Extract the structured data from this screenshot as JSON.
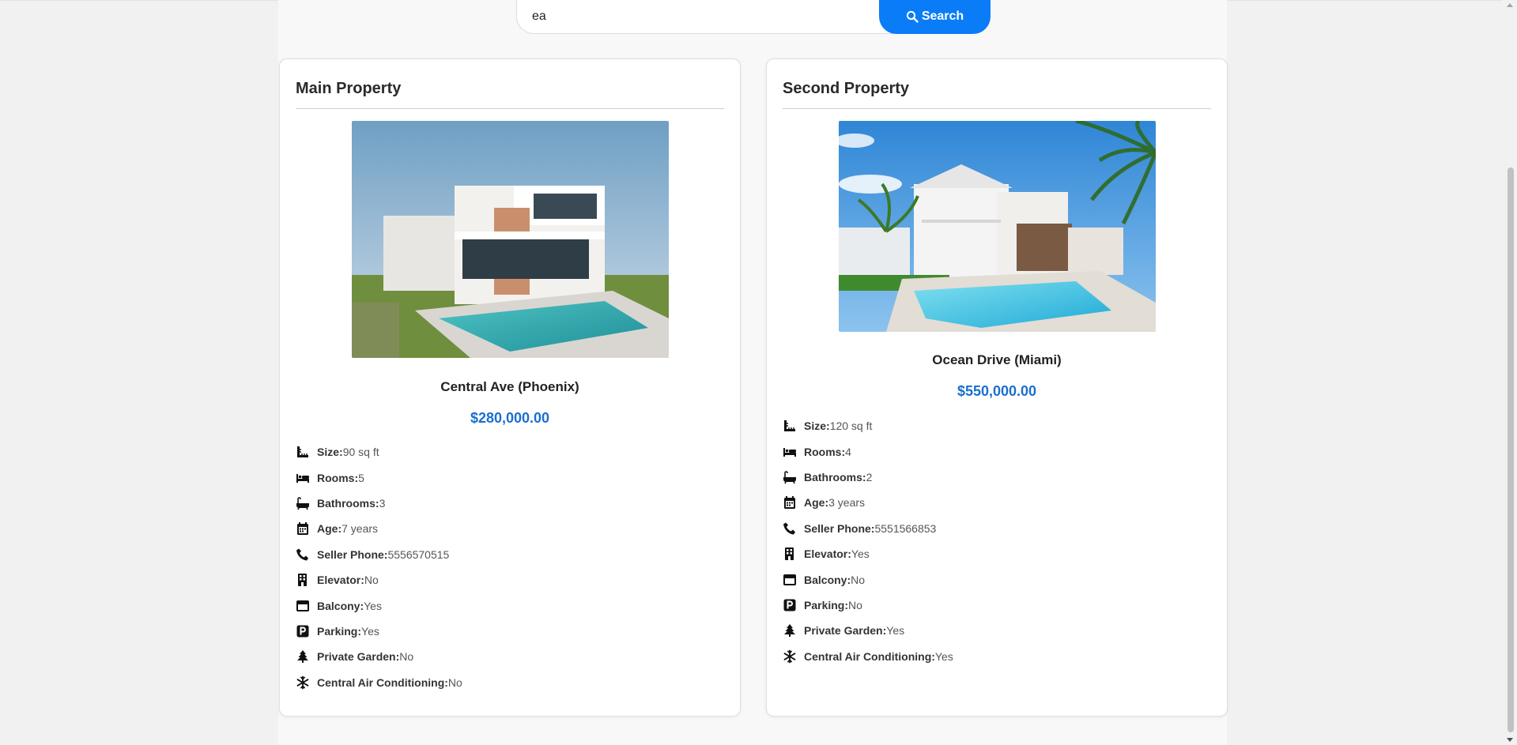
{
  "search": {
    "value": "ea",
    "placeholder": "",
    "button_label": "Search"
  },
  "properties": [
    {
      "section_title": "Main Property",
      "name": "Central Ave (Phoenix)",
      "price": "$280,000.00",
      "details": [
        {
          "icon": "ruler-icon",
          "label": "Size:",
          "value": "90 sq ft"
        },
        {
          "icon": "bed-icon",
          "label": "Rooms:",
          "value": "5"
        },
        {
          "icon": "bath-icon",
          "label": "Bathrooms:",
          "value": "3"
        },
        {
          "icon": "calendar-icon",
          "label": "Age:",
          "value": "7 years"
        },
        {
          "icon": "phone-icon",
          "label": "Seller Phone:",
          "value": "5556570515"
        },
        {
          "icon": "building-icon",
          "label": "Elevator:",
          "value": "No"
        },
        {
          "icon": "balcony-icon",
          "label": "Balcony:",
          "value": "Yes"
        },
        {
          "icon": "parking-icon",
          "label": "Parking:",
          "value": "Yes"
        },
        {
          "icon": "tree-icon",
          "label": "Private Garden:",
          "value": "No"
        },
        {
          "icon": "snowflake-icon",
          "label": "Central Air Conditioning:",
          "value": "No"
        }
      ]
    },
    {
      "section_title": "Second Property",
      "name": "Ocean Drive (Miami)",
      "price": "$550,000.00",
      "details": [
        {
          "icon": "ruler-icon",
          "label": "Size:",
          "value": "120 sq ft"
        },
        {
          "icon": "bed-icon",
          "label": "Rooms:",
          "value": "4"
        },
        {
          "icon": "bath-icon",
          "label": "Bathrooms:",
          "value": "2"
        },
        {
          "icon": "calendar-icon",
          "label": "Age:",
          "value": "3 years"
        },
        {
          "icon": "phone-icon",
          "label": "Seller Phone:",
          "value": "5551566853"
        },
        {
          "icon": "building-icon",
          "label": "Elevator:",
          "value": "Yes"
        },
        {
          "icon": "balcony-icon",
          "label": "Balcony:",
          "value": "No"
        },
        {
          "icon": "parking-icon",
          "label": "Parking:",
          "value": "No"
        },
        {
          "icon": "tree-icon",
          "label": "Private Garden:",
          "value": "Yes"
        },
        {
          "icon": "snowflake-icon",
          "label": "Central Air Conditioning:",
          "value": "Yes"
        }
      ]
    }
  ],
  "colors": {
    "accent": "#0a7cf7",
    "price": "#1a6fd0"
  }
}
